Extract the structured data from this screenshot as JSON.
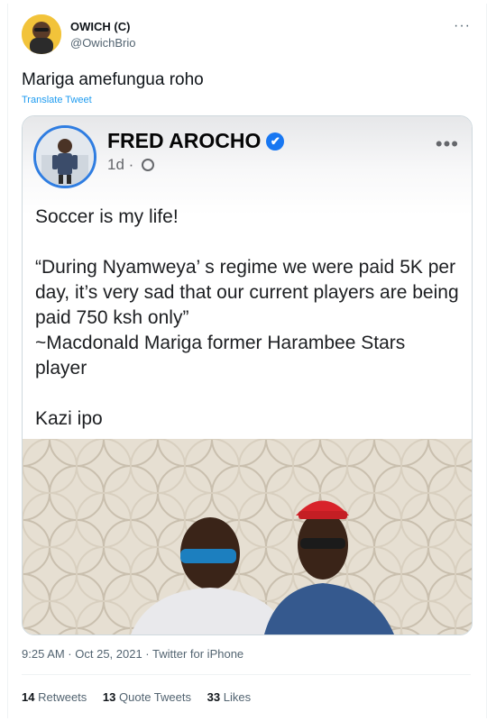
{
  "tweet": {
    "author_name": "OWICH (C)",
    "author_handle": "@OwichBrio",
    "more_label": "···",
    "text": "Mariga amefungua roho",
    "translate_label": "Translate Tweet",
    "timestamp": "9:25 AM · Oct 25, 2021 · Twitter for iPhone",
    "stats": {
      "retweets_count": "14",
      "retweets_label": "Retweets",
      "quotes_count": "13",
      "quotes_label": "Quote Tweets",
      "likes_count": "33",
      "likes_label": "Likes"
    }
  },
  "embedded_post": {
    "author_name": "FRED AROCHO",
    "verified_icon": "✔",
    "age": "1d",
    "separator": "·",
    "more_label": "•••",
    "body": "Soccer is my life!\n\n“During Nyamweya’ s regime we were paid 5K per day, it’s very sad that our current players are being paid 750 ksh only”\n~Macdonald Mariga former Harambee Stars player\n\nKazi ipo"
  },
  "colors": {
    "link_blue": "#1d9bf0",
    "fb_verified_blue": "#1877f2",
    "text_secondary": "#536471"
  }
}
